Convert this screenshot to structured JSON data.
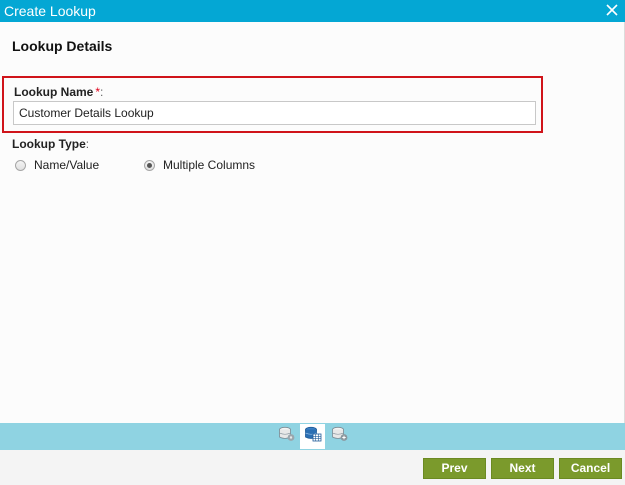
{
  "window": {
    "title": "Create Lookup",
    "close_icon": "close-icon"
  },
  "section": {
    "heading": "Lookup Details"
  },
  "lookup_name": {
    "label": "Lookup Name",
    "required_marker": "*",
    "colon": ":",
    "value": "Customer Details Lookup",
    "highlight_color": "#d0141a"
  },
  "lookup_type": {
    "label": "Lookup Type",
    "colon": ":",
    "options": [
      {
        "label": "Name/Value",
        "selected": false
      },
      {
        "label": "Multiple Columns",
        "selected": true
      }
    ]
  },
  "steps": {
    "icons": [
      "database-settings-icon",
      "database-table-icon",
      "database-config-icon"
    ],
    "active_index": 1
  },
  "buttons": {
    "prev": "Prev",
    "next": "Next",
    "cancel": "Cancel"
  },
  "colors": {
    "titlebar": "#04a7d4",
    "stepbar": "#8fd3e2",
    "button": "#7b9a2c"
  }
}
